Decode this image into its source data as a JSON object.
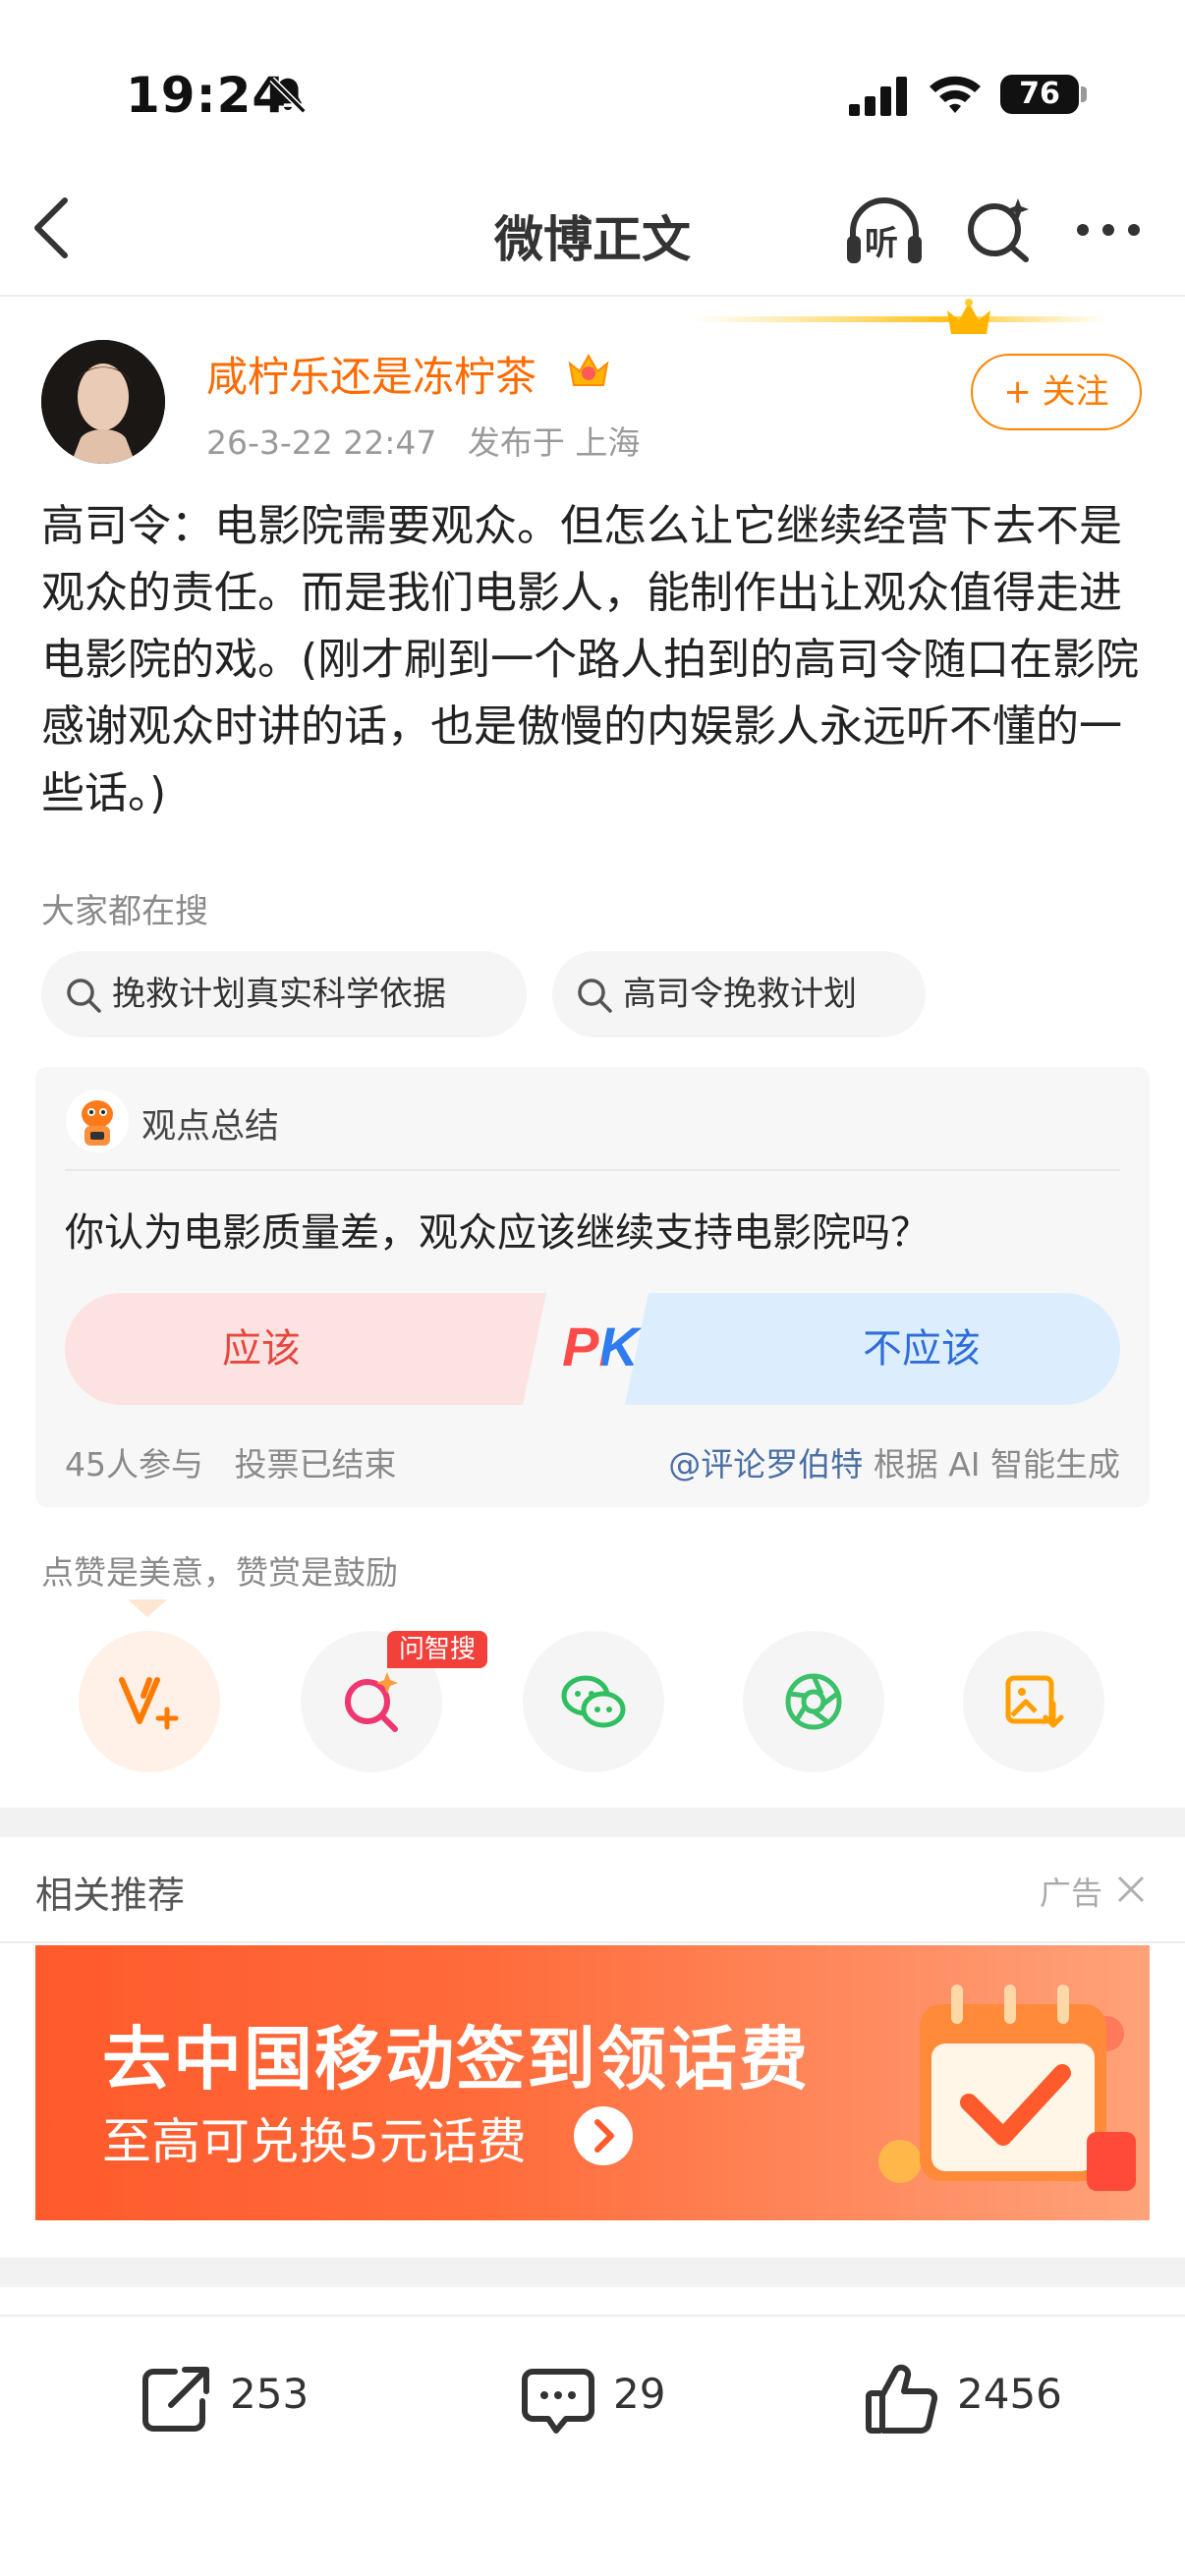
{
  "status_bar": {
    "time": "19:24",
    "battery": "76"
  },
  "nav": {
    "title": "微博正文",
    "listen_label": "听"
  },
  "author": {
    "name": "咸柠乐还是冻柠茶",
    "date": "26-3-22 22:47",
    "location": "发布于 上海"
  },
  "follow_label": "+ 关注",
  "post_text": "高司令：电影院需要观众。但怎么让它继续经营下去不是观众的责任。而是我们电影人，能制作出让观众值得走进电影院的戏。(刚才刷到一个路人拍到的高司令随口在影院感谢观众时讲的话，也是傲慢的内娱影人永远听不懂的一些话。)",
  "search_section": {
    "title": "大家都在搜",
    "queries": [
      "挽救计划真实科学依据",
      "高司令挽救计划"
    ]
  },
  "poll": {
    "header": "观点总结",
    "question": "你认为电影质量差，观众应该继续支持电影院吗？",
    "option_yes": "应该",
    "pk_label": "PK",
    "option_no": "不应该",
    "participants": "45人参与",
    "status": "投票已结束",
    "credit_link": "@评论罗伯特",
    "credit_suffix": " 根据 AI 智能生成"
  },
  "reward_tip": "点赞是美意，赞赏是鼓励",
  "share_badge": "问智搜",
  "related": {
    "title": "相关推荐",
    "ad_label": "广告"
  },
  "ad_banner": {
    "title": "去中国移动签到领话费",
    "subtitle": "至高可兑换5元话费"
  },
  "bottom_bar": {
    "reposts": "253",
    "comments": "29",
    "likes": "2456"
  },
  "colors": {
    "accent_orange": "#ff8200",
    "poll_yes": "#e8473e",
    "poll_no": "#2f6ed8",
    "banner": "#ff5a2c"
  }
}
